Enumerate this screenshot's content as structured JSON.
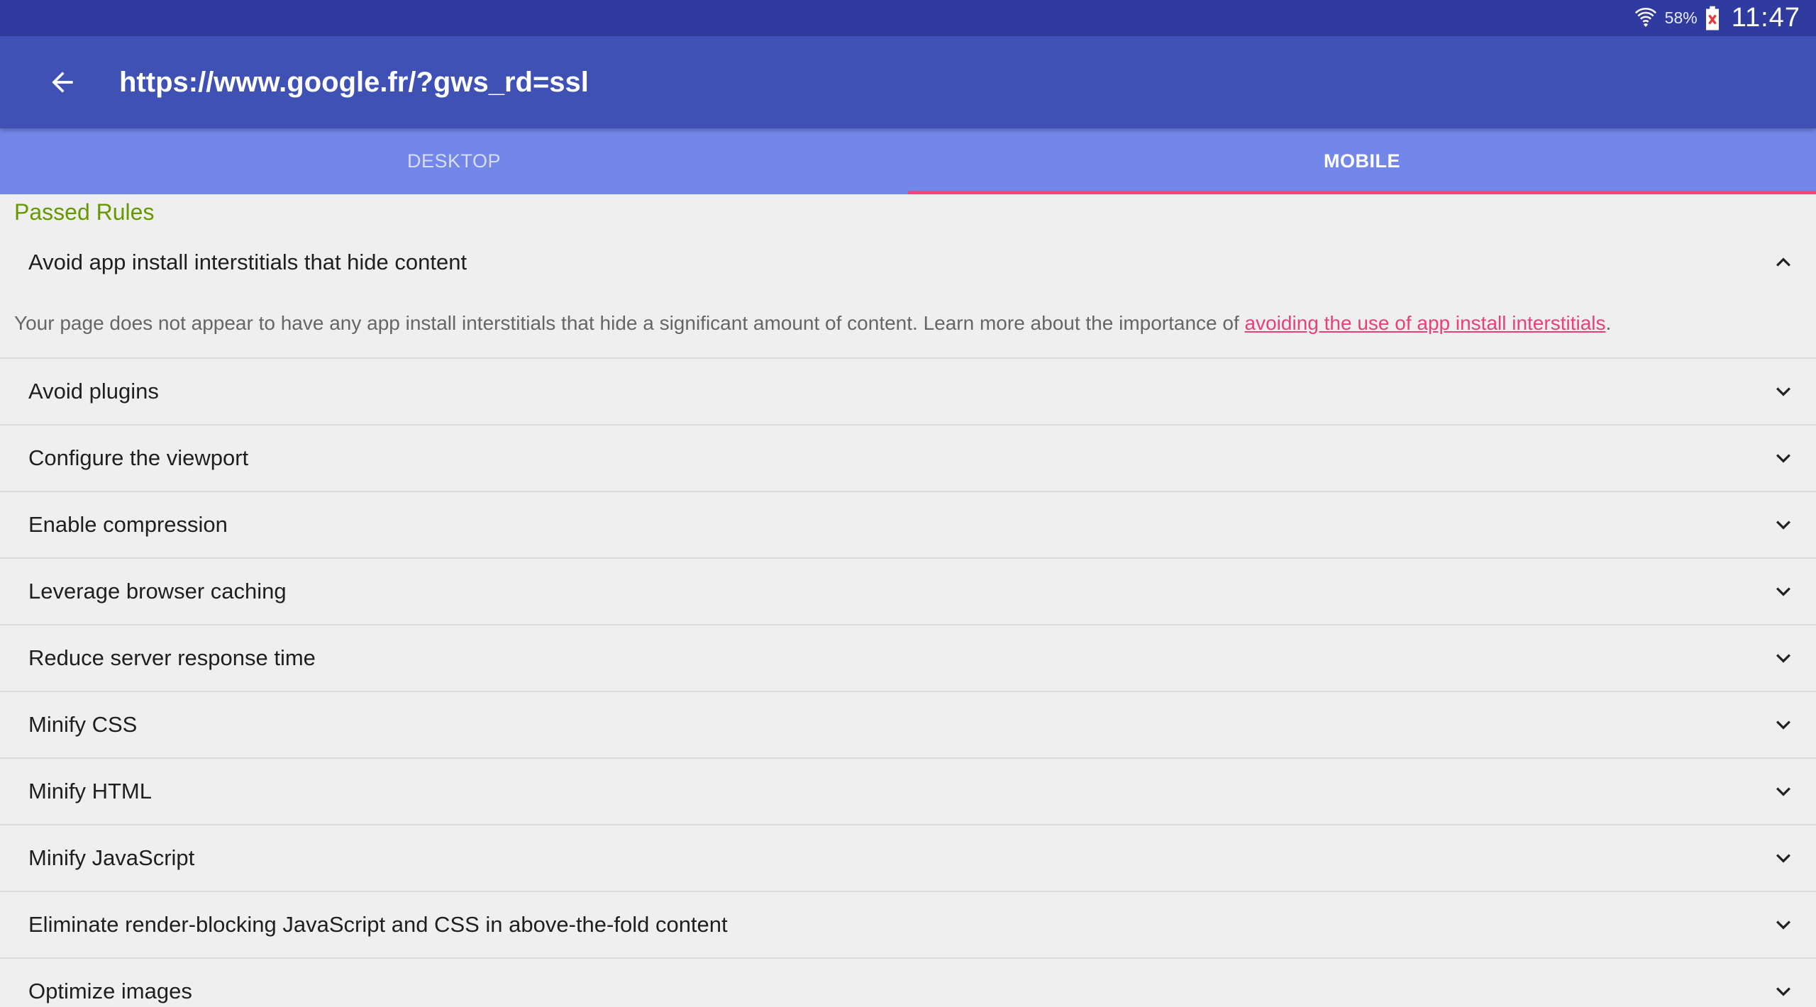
{
  "status_bar": {
    "battery_percent": "58%",
    "time": "11:47",
    "icons": [
      "wifi-icon",
      "battery-charging-error-icon"
    ]
  },
  "app_bar": {
    "back_icon": "arrow-back-icon",
    "url": "https://www.google.fr/?gws_rd=ssl"
  },
  "tabs": [
    {
      "label": "DESKTOP",
      "active": false
    },
    {
      "label": "MOBILE",
      "active": true
    }
  ],
  "colors": {
    "status_bar": "#2f3b9e",
    "app_bar": "#3f51b5",
    "tab_bar": "#7387e8",
    "tab_indicator": "#ff4081",
    "section_title": "#669900",
    "link": "#e8407a"
  },
  "section": {
    "title": "Passed Rules"
  },
  "expanded_rule": {
    "title": "Avoid app install interstitials that hide content",
    "description": "Your page does not appear to have any app install interstitials that hide a significant amount of content. Learn more about the importance of ",
    "link_text": "avoiding the use of app install interstitials",
    "after_link": ".",
    "icon": "chevron-up-icon"
  },
  "rules": [
    {
      "title": "Avoid plugins",
      "icon": "chevron-down-icon"
    },
    {
      "title": "Configure the viewport",
      "icon": "chevron-down-icon"
    },
    {
      "title": "Enable compression",
      "icon": "chevron-down-icon"
    },
    {
      "title": "Leverage browser caching",
      "icon": "chevron-down-icon"
    },
    {
      "title": "Reduce server response time",
      "icon": "chevron-down-icon"
    },
    {
      "title": "Minify CSS",
      "icon": "chevron-down-icon"
    },
    {
      "title": "Minify HTML",
      "icon": "chevron-down-icon"
    },
    {
      "title": "Minify JavaScript",
      "icon": "chevron-down-icon"
    },
    {
      "title": "Eliminate render-blocking JavaScript and CSS in above-the-fold content",
      "icon": "chevron-down-icon"
    },
    {
      "title": "Optimize images",
      "icon": "chevron-down-icon"
    }
  ]
}
